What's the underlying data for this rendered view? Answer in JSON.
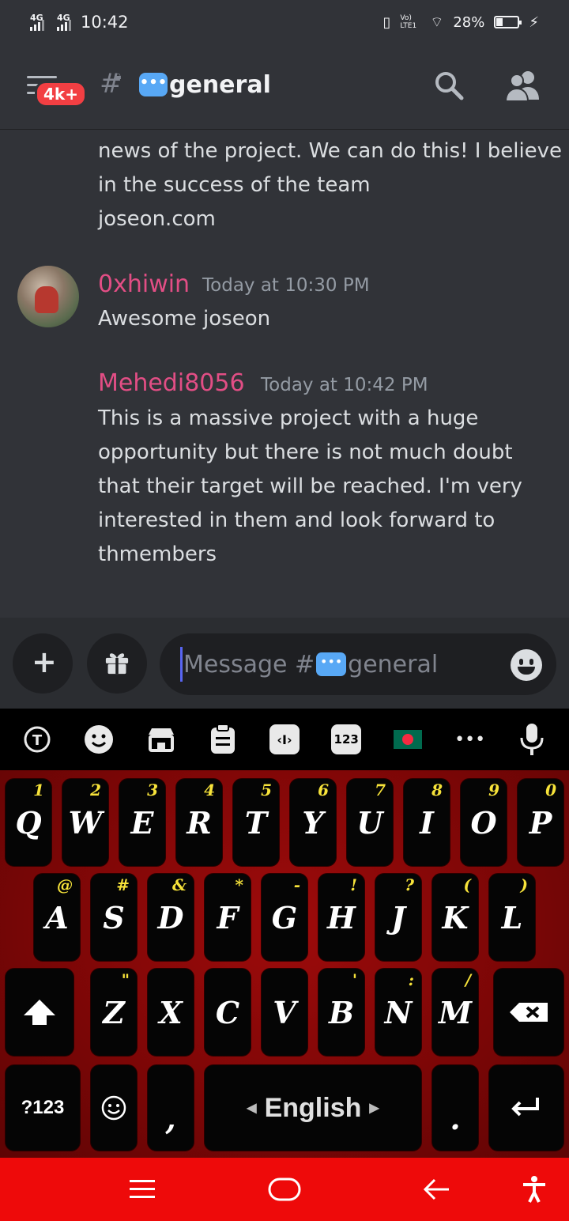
{
  "status_bar": {
    "network1": "4G",
    "network2": "4G",
    "time": "10:42",
    "volte": "Vo) LTE1",
    "battery_percent": "28%"
  },
  "header": {
    "notification_badge": "4k+",
    "channel_name": "general",
    "channel_emoji_icon": "speech-bubble-icon"
  },
  "messages": {
    "continued_lines": [
      "news of the project. We can do this! I believe",
      "in the success of the team",
      "joseon.com"
    ],
    "items": [
      {
        "username": "0xhiwin",
        "timestamp": "Today at 10:30 PM",
        "lines": [
          "Awesome joseon"
        ]
      },
      {
        "username": "Mehedi8056",
        "timestamp": "Today at 10:42 PM",
        "lines": [
          "This is a massive project with a huge",
          "opportunity but there is not much doubt",
          "that their target will be reached. I'm very",
          "interested in them and look forward to",
          "thmembers"
        ]
      }
    ],
    "username_color": "#e24e85"
  },
  "composer": {
    "placeholder_prefix": "Message #",
    "placeholder_channel": "general"
  },
  "keyboard": {
    "toolbar_icons": [
      "translate-icon",
      "emoji-icon",
      "store-icon",
      "clipboard-icon",
      "cursor-edit-icon",
      "numpad-icon",
      "bangladesh-flag-icon",
      "more-icon",
      "microphone-icon"
    ],
    "numpad_label": "123",
    "more_label": "•••",
    "row1": [
      {
        "key": "Q",
        "hint": "1"
      },
      {
        "key": "W",
        "hint": "2"
      },
      {
        "key": "E",
        "hint": "3"
      },
      {
        "key": "R",
        "hint": "4"
      },
      {
        "key": "T",
        "hint": "5"
      },
      {
        "key": "Y",
        "hint": "6"
      },
      {
        "key": "U",
        "hint": "7"
      },
      {
        "key": "I",
        "hint": "8"
      },
      {
        "key": "O",
        "hint": "9"
      },
      {
        "key": "P",
        "hint": "0"
      }
    ],
    "row2": [
      {
        "key": "A",
        "hint": "@"
      },
      {
        "key": "S",
        "hint": "#"
      },
      {
        "key": "D",
        "hint": "&"
      },
      {
        "key": "F",
        "hint": "*"
      },
      {
        "key": "G",
        "hint": "-"
      },
      {
        "key": "H",
        "hint": "!"
      },
      {
        "key": "J",
        "hint": "?"
      },
      {
        "key": "K",
        "hint": "("
      },
      {
        "key": "L",
        "hint": ")"
      }
    ],
    "row3": [
      {
        "key": "Z",
        "hint": "\""
      },
      {
        "key": "X",
        "hint": ""
      },
      {
        "key": "C",
        "hint": ""
      },
      {
        "key": "V",
        "hint": ""
      },
      {
        "key": "B",
        "hint": "'"
      },
      {
        "key": "N",
        "hint": ":"
      },
      {
        "key": "M",
        "hint": "/"
      }
    ],
    "symbols_key": "?123",
    "comma_key": ",",
    "space_label": "English",
    "period_key": ".",
    "accent_color": "#f7e33a",
    "background_color": "#8b0808"
  },
  "nav_bar": {
    "icons": [
      "recents-icon",
      "home-icon",
      "back-icon",
      "accessibility-icon"
    ],
    "color": "#ee0a0a"
  }
}
